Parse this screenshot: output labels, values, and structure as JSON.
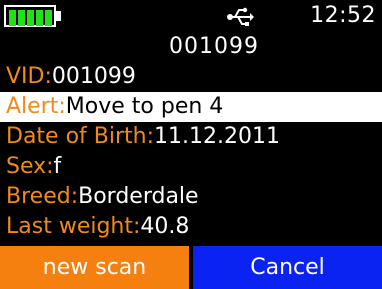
{
  "status": {
    "battery_icon": "battery-full-icon",
    "battery_color": "#22e01a",
    "usb_icon": "usb-icon",
    "time": "12:52"
  },
  "animal_id": "001099",
  "fields": {
    "vid": {
      "label": "VID:",
      "value": "001099"
    },
    "alert": {
      "label": "Alert:",
      "value": "Move to pen 4"
    },
    "dob": {
      "label": "Date of Birth:",
      "value": "11.12.2011"
    },
    "sex": {
      "label": "Sex:",
      "value": "f"
    },
    "breed": {
      "label": "Breed:",
      "value": "Borderdale"
    },
    "weight": {
      "label": "Last weight:",
      "value": "40.8"
    }
  },
  "softkeys": {
    "left": "new scan",
    "right": "Cancel"
  },
  "colors": {
    "label": "#f28a1a",
    "left_key": "#f5800f",
    "right_key": "#0a22f2"
  }
}
